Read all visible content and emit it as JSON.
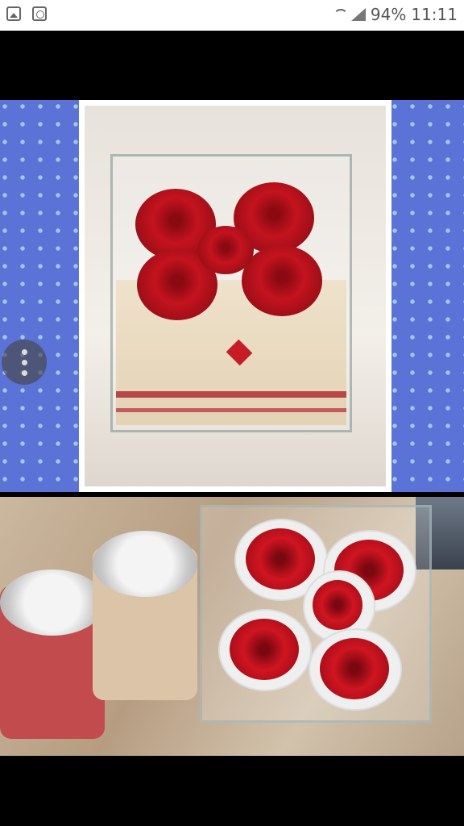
{
  "status_bar": {
    "battery": "94%",
    "time": "11:11"
  },
  "icons": {
    "menu": "more-vert-icon"
  },
  "colors": {
    "background": "#000000",
    "pattern_blue": "#5b72d6"
  }
}
